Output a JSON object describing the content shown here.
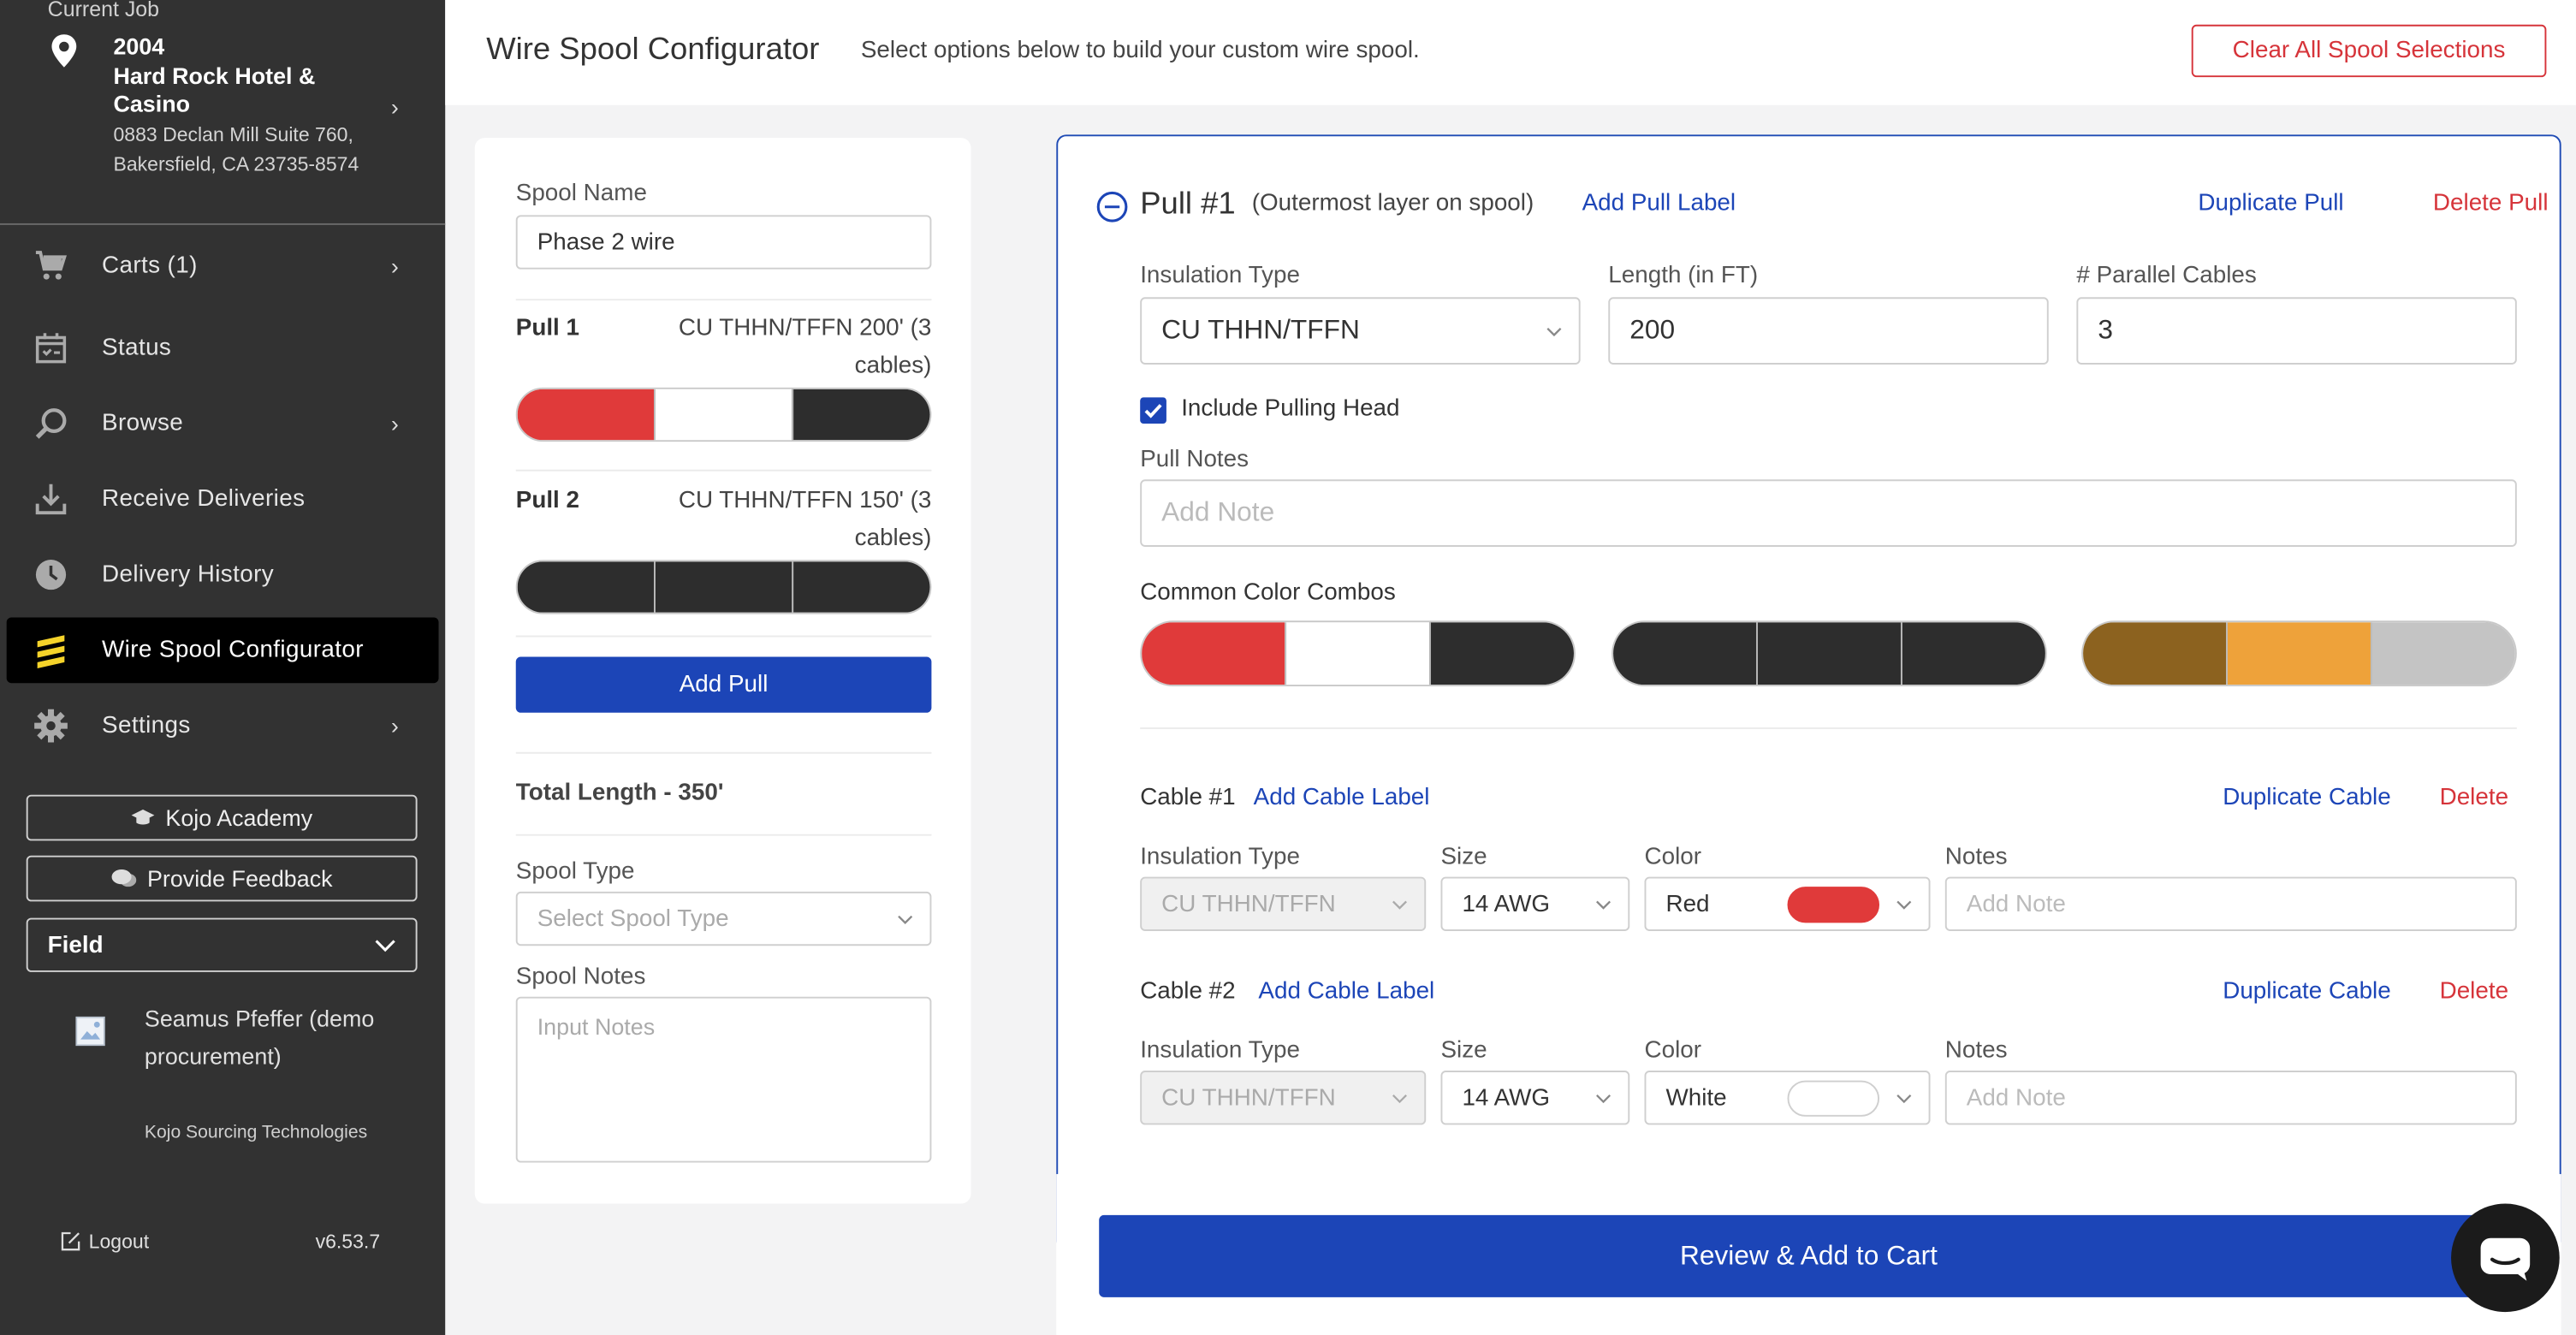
{
  "sidebar": {
    "current_job_caption": "Current Job",
    "job_number": "2004",
    "job_name": "Hard Rock Hotel & Casino",
    "job_address": "0883 Declan Mill Suite 760, Bakersfield, CA 23735-8574",
    "nav": [
      {
        "label": "Carts (1)",
        "icon": "cart-icon",
        "chevron": true
      },
      {
        "label": "Status",
        "icon": "calendar-check-icon",
        "chevron": false
      },
      {
        "label": "Browse",
        "icon": "search-icon",
        "chevron": true
      },
      {
        "label": "Receive Deliveries",
        "icon": "download-icon",
        "chevron": false
      },
      {
        "label": "Delivery History",
        "icon": "clock-icon",
        "chevron": false
      },
      {
        "label": "Wire Spool Configurator",
        "icon": "spool-icon",
        "chevron": false,
        "active": true
      },
      {
        "label": "Settings",
        "icon": "gear-icon",
        "chevron": true
      }
    ],
    "academy_label": "Kojo Academy",
    "feedback_label": "Provide Feedback",
    "role_value": "Field",
    "user_name": "Seamus Pfeffer (demo procurement)",
    "user_org": "Kojo Sourcing Technologies",
    "logout_label": "Logout",
    "version": "v6.53.7"
  },
  "header": {
    "title": "Wire Spool Configurator",
    "subtitle": "Select options below to build your custom wire spool.",
    "clear_button": "Clear All Spool Selections"
  },
  "summary": {
    "spool_name_label": "Spool Name",
    "spool_name_value": "Phase 2 wire",
    "pulls": [
      {
        "title": "Pull 1",
        "desc": "CU THHN/TFFN 200' (3 cables)",
        "colors": [
          "#e03a3a",
          "#ffffff",
          "#2d2d2d"
        ]
      },
      {
        "title": "Pull 2",
        "desc": "CU THHN/TFFN 150' (3 cables)",
        "colors": [
          "#2d2d2d",
          "#2d2d2d",
          "#2d2d2d"
        ]
      }
    ],
    "add_pull_label": "Add Pull",
    "total_length": "Total Length - 350'",
    "spool_type_label": "Spool Type",
    "spool_type_placeholder": "Select Spool Type",
    "spool_notes_label": "Spool Notes",
    "spool_notes_placeholder": "Input Notes"
  },
  "pull": {
    "title": "Pull #1",
    "subtitle": "(Outermost layer on spool)",
    "add_label": "Add Pull Label",
    "duplicate": "Duplicate Pull",
    "delete": "Delete Pull",
    "insulation_label": "Insulation Type",
    "insulation_value": "CU THHN/TFFN",
    "length_label": "Length (in FT)",
    "length_value": "200",
    "parallel_label": "# Parallel Cables",
    "parallel_value": "3",
    "pulling_head_label": "Include Pulling Head",
    "pulling_head_checked": true,
    "notes_label": "Pull Notes",
    "notes_placeholder": "Add Note",
    "combos_label": "Common Color Combos",
    "combos": [
      [
        "#e03a3a",
        "#ffffff",
        "#2d2d2d"
      ],
      [
        "#2d2d2d",
        "#2d2d2d",
        "#2d2d2d"
      ],
      [
        "#8c621f",
        "#eea23a",
        "#c4c4c4"
      ]
    ]
  },
  "cables": [
    {
      "title": "Cable #1",
      "add_label": "Add Cable Label",
      "duplicate": "Duplicate Cable",
      "delete": "Delete",
      "insulation_label": "Insulation Type",
      "insulation_value": "CU THHN/TFFN",
      "size_label": "Size",
      "size_value": "14 AWG",
      "color_label": "Color",
      "color_value": "Red",
      "color_hex": "#e03a3a",
      "notes_label": "Notes",
      "notes_placeholder": "Add Note"
    },
    {
      "title": "Cable #2",
      "add_label": "Add Cable Label",
      "duplicate": "Duplicate Cable",
      "delete": "Delete",
      "insulation_label": "Insulation Type",
      "insulation_value": "CU THHN/TFFN",
      "size_label": "Size",
      "size_value": "14 AWG",
      "color_label": "Color",
      "color_value": "White",
      "color_hex": "#ffffff",
      "notes_label": "Notes",
      "notes_placeholder": "Add Note"
    }
  ],
  "footer": {
    "review_button": "Review & Add to Cart"
  },
  "colors": {
    "accent": "#1c45b7",
    "danger": "#d6343a",
    "sidebar_bg": "#323232"
  }
}
